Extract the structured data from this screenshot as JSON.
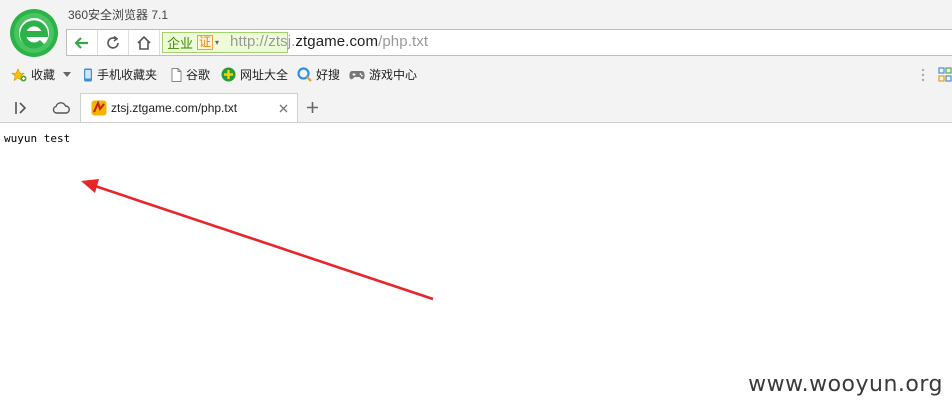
{
  "app": {
    "title": "360安全浏览器 7.1"
  },
  "navbar": {
    "back_icon": "arrow-left-icon",
    "refresh_icon": "refresh-icon",
    "home_icon": "home-icon",
    "cert_label": "企业",
    "cert_badge": "证",
    "cert_dropdown": "▾",
    "url_prefix": "http://ztsj.",
    "url_domain": "ztgame.com",
    "url_path": "/php.txt",
    "accent": "#3a8a00"
  },
  "bookmarks": {
    "favorites": "收藏",
    "mobile_favorites": "手机收藏夹",
    "google": "谷歌",
    "site_directory": "网址大全",
    "haosou": "好搜",
    "games": "游戏中心"
  },
  "tabs": [
    {
      "title": "ztsj.ztgame.com/php.txt",
      "active": true
    }
  ],
  "content": {
    "text": "wuyun test",
    "annotation_color": "#e8262a"
  },
  "watermark": "www.wooyun.org"
}
